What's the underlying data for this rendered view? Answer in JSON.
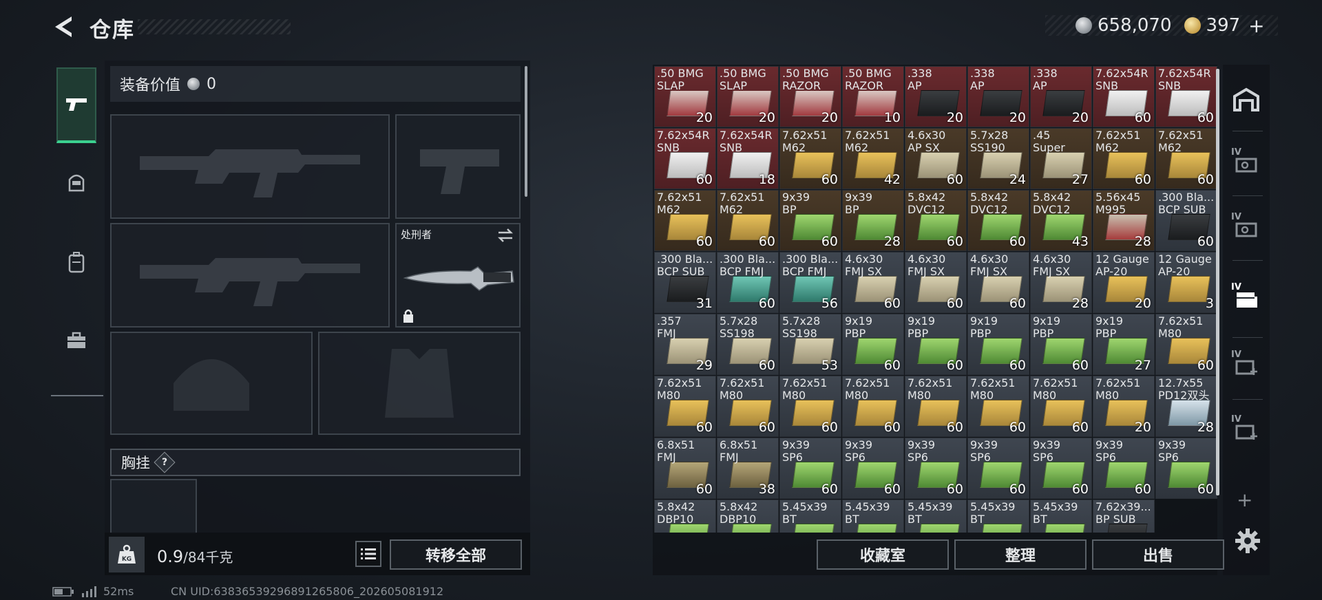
{
  "header": {
    "title": "仓库"
  },
  "currency": {
    "silver": "658,070",
    "gold": "397"
  },
  "equipment": {
    "value_label": "装备价值",
    "value": "0",
    "knife_name": "处刑者",
    "chest_rig_label": "胸挂",
    "help_symbol": "?"
  },
  "bottom_left": {
    "kg_label": "KG",
    "weight_current": "0.9",
    "weight_capacity": "/84千克",
    "transfer_all": "转移全部"
  },
  "status": {
    "ping": "52ms",
    "uid": "CN UID:63836539296891265806_202605081912"
  },
  "inventory": {
    "rows": [
      [
        {
          "name": ".50 BMG\nSLAP",
          "qty": "20",
          "bg": "red",
          "box": "red"
        },
        {
          "name": ".50 BMG\nSLAP",
          "qty": "20",
          "bg": "red",
          "box": "red"
        },
        {
          "name": ".50 BMG\nRAZOR",
          "qty": "20",
          "bg": "red",
          "box": "red"
        },
        {
          "name": ".50 BMG\nRAZOR",
          "qty": "10",
          "bg": "red",
          "box": "red"
        },
        {
          "name": ".338\nAP",
          "qty": "20",
          "bg": "red",
          "box": "black"
        },
        {
          "name": ".338\nAP",
          "qty": "20",
          "bg": "red",
          "box": "black"
        },
        {
          "name": ".338\nAP",
          "qty": "20",
          "bg": "red",
          "box": "black"
        },
        {
          "name": "7.62x54R\nSNB",
          "qty": "60",
          "bg": "red",
          "box": "white"
        },
        {
          "name": "7.62x54R\nSNB",
          "qty": "60",
          "bg": "red",
          "box": "white"
        }
      ],
      [
        {
          "name": "7.62x54R\nSNB",
          "qty": "60",
          "bg": "red",
          "box": "white"
        },
        {
          "name": "7.62x54R\nSNB",
          "qty": "18",
          "bg": "red",
          "box": "white"
        },
        {
          "name": "7.62x51\nM62",
          "qty": "60",
          "bg": "brown",
          "box": "gold"
        },
        {
          "name": "7.62x51\nM62",
          "qty": "42",
          "bg": "brown",
          "box": "gold"
        },
        {
          "name": "4.6x30\nAP SX",
          "qty": "60",
          "bg": "brown",
          "box": "tan"
        },
        {
          "name": "5.7x28\nSS190",
          "qty": "24",
          "bg": "brown",
          "box": "tan"
        },
        {
          "name": ".45\nSuper",
          "qty": "27",
          "bg": "brown",
          "box": "tan"
        },
        {
          "name": "7.62x51\nM62",
          "qty": "60",
          "bg": "brown",
          "box": "gold"
        },
        {
          "name": "7.62x51\nM62",
          "qty": "60",
          "bg": "brown",
          "box": "gold"
        }
      ],
      [
        {
          "name": "7.62x51\nM62",
          "qty": "60",
          "bg": "brown",
          "box": "gold"
        },
        {
          "name": "7.62x51\nM62",
          "qty": "60",
          "bg": "brown",
          "box": "gold"
        },
        {
          "name": "9x39\nBP",
          "qty": "60",
          "bg": "brown",
          "box": "green"
        },
        {
          "name": "9x39\nBP",
          "qty": "28",
          "bg": "brown",
          "box": "green"
        },
        {
          "name": "5.8x42\nDVC12",
          "qty": "60",
          "bg": "brown",
          "box": "green"
        },
        {
          "name": "5.8x42\nDVC12",
          "qty": "60",
          "bg": "brown",
          "box": "green"
        },
        {
          "name": "5.8x42\nDVC12",
          "qty": "43",
          "bg": "brown",
          "box": "green"
        },
        {
          "name": "5.56x45\nM995",
          "qty": "28",
          "bg": "brown",
          "box": "mixred"
        },
        {
          "name": ".300 Bla...\nBCP SUB",
          "qty": "60",
          "bg": "gray",
          "box": "black"
        }
      ],
      [
        {
          "name": ".300 Bla...\nBCP SUB",
          "qty": "31",
          "bg": "gray",
          "box": "black"
        },
        {
          "name": ".300 Bla...\nBCP FMJ",
          "qty": "60",
          "bg": "gray",
          "box": "teal"
        },
        {
          "name": ".300 Bla...\nBCP FMJ",
          "qty": "56",
          "bg": "gray",
          "box": "teal"
        },
        {
          "name": "4.6x30\nFMJ SX",
          "qty": "60",
          "bg": "gray",
          "box": "tan"
        },
        {
          "name": "4.6x30\nFMJ SX",
          "qty": "60",
          "bg": "gray",
          "box": "tan"
        },
        {
          "name": "4.6x30\nFMJ SX",
          "qty": "60",
          "bg": "gray",
          "box": "tan"
        },
        {
          "name": "4.6x30\nFMJ SX",
          "qty": "28",
          "bg": "gray",
          "box": "tan"
        },
        {
          "name": "12 Gauge\nAP-20",
          "qty": "20",
          "bg": "gray",
          "box": "gold"
        },
        {
          "name": "12 Gauge\nAP-20",
          "qty": "3",
          "bg": "gray",
          "box": "gold"
        }
      ],
      [
        {
          "name": ".357\nFMJ",
          "qty": "29",
          "bg": "gray",
          "box": "tan"
        },
        {
          "name": "5.7x28\nSS198",
          "qty": "60",
          "bg": "gray",
          "box": "tan"
        },
        {
          "name": "5.7x28\nSS198",
          "qty": "53",
          "bg": "gray",
          "box": "tan"
        },
        {
          "name": "9x19\nPBP",
          "qty": "60",
          "bg": "gray",
          "box": "green"
        },
        {
          "name": "9x19\nPBP",
          "qty": "60",
          "bg": "gray",
          "box": "green"
        },
        {
          "name": "9x19\nPBP",
          "qty": "60",
          "bg": "gray",
          "box": "green"
        },
        {
          "name": "9x19\nPBP",
          "qty": "60",
          "bg": "gray",
          "box": "green"
        },
        {
          "name": "9x19\nPBP",
          "qty": "27",
          "bg": "gray",
          "box": "green"
        },
        {
          "name": "7.62x51\nM80",
          "qty": "60",
          "bg": "gray",
          "box": "gold"
        }
      ],
      [
        {
          "name": "7.62x51\nM80",
          "qty": "60",
          "bg": "gray",
          "box": "gold"
        },
        {
          "name": "7.62x51\nM80",
          "qty": "60",
          "bg": "gray",
          "box": "gold"
        },
        {
          "name": "7.62x51\nM80",
          "qty": "60",
          "bg": "gray",
          "box": "gold"
        },
        {
          "name": "7.62x51\nM80",
          "qty": "60",
          "bg": "gray",
          "box": "gold"
        },
        {
          "name": "7.62x51\nM80",
          "qty": "60",
          "bg": "gray",
          "box": "gold"
        },
        {
          "name": "7.62x51\nM80",
          "qty": "60",
          "bg": "gray",
          "box": "gold"
        },
        {
          "name": "7.62x51\nM80",
          "qty": "60",
          "bg": "gray",
          "box": "gold"
        },
        {
          "name": "7.62x51\nM80",
          "qty": "20",
          "bg": "gray",
          "box": "gold"
        },
        {
          "name": "12.7x55\nPD12双头",
          "qty": "28",
          "bg": "gray",
          "box": "silver"
        }
      ],
      [
        {
          "name": "6.8x51\nFMJ",
          "qty": "60",
          "bg": "gray",
          "box": "olive"
        },
        {
          "name": "6.8x51\nFMJ",
          "qty": "38",
          "bg": "gray",
          "box": "olive"
        },
        {
          "name": "9x39\nSP6",
          "qty": "60",
          "bg": "gray",
          "box": "green"
        },
        {
          "name": "9x39\nSP6",
          "qty": "60",
          "bg": "gray",
          "box": "green"
        },
        {
          "name": "9x39\nSP6",
          "qty": "60",
          "bg": "gray",
          "box": "green"
        },
        {
          "name": "9x39\nSP6",
          "qty": "60",
          "bg": "gray",
          "box": "green"
        },
        {
          "name": "9x39\nSP6",
          "qty": "60",
          "bg": "gray",
          "box": "green"
        },
        {
          "name": "9x39\nSP6",
          "qty": "60",
          "bg": "gray",
          "box": "green"
        },
        {
          "name": "9x39\nSP6",
          "qty": "60",
          "bg": "gray",
          "box": "green"
        }
      ],
      [
        {
          "name": "5.8x42\nDBP10",
          "qty": "",
          "bg": "gray",
          "box": "green"
        },
        {
          "name": "5.8x42\nDBP10",
          "qty": "",
          "bg": "gray",
          "box": "green"
        },
        {
          "name": "5.45x39\nBT",
          "qty": "",
          "bg": "gray",
          "box": "green"
        },
        {
          "name": "5.45x39\nBT",
          "qty": "",
          "bg": "gray",
          "box": "green"
        },
        {
          "name": "5.45x39\nBT",
          "qty": "",
          "bg": "gray",
          "box": "green"
        },
        {
          "name": "5.45x39\nBT",
          "qty": "",
          "bg": "gray",
          "box": "green"
        },
        {
          "name": "5.45x39\nBT",
          "qty": "",
          "bg": "gray",
          "box": "green"
        },
        {
          "name": "7.62x39...\nBP SUB",
          "qty": "",
          "bg": "gray",
          "box": "black"
        }
      ]
    ]
  },
  "right_rail": {
    "iv_label": "IV",
    "add_symbol": "+"
  },
  "bottom_right": {
    "collection": "收藏室",
    "sort": "整理",
    "sell": "出售"
  }
}
